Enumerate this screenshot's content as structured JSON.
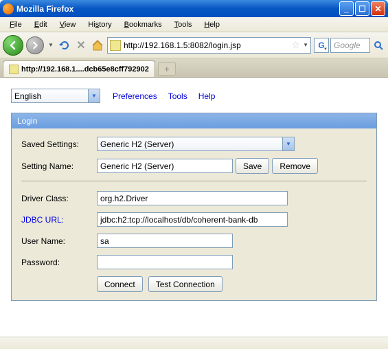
{
  "window": {
    "title": "Mozilla Firefox"
  },
  "menu": {
    "file": "File",
    "edit": "Edit",
    "view": "View",
    "history": "History",
    "bookmarks": "Bookmarks",
    "tools": "Tools",
    "help": "Help"
  },
  "nav": {
    "url": "http://192.168.1.5:8082/login.jsp",
    "search_placeholder": "Google"
  },
  "tab": {
    "title": "http://192.168.1....dcb65e8cff792902"
  },
  "toprow": {
    "language": "English",
    "preferences": "Preferences",
    "tools": "Tools",
    "help": "Help"
  },
  "panel": {
    "title": "Login",
    "labels": {
      "saved_settings": "Saved Settings:",
      "setting_name": "Setting Name:",
      "driver_class": "Driver Class:",
      "jdbc_url": "JDBC URL:",
      "user_name": "User Name:",
      "password": "Password:"
    },
    "values": {
      "saved_settings": "Generic H2 (Server)",
      "setting_name": "Generic H2 (Server)",
      "driver_class": "org.h2.Driver",
      "jdbc_url": "jdbc:h2:tcp://localhost/db/coherent-bank-db",
      "user_name": "sa",
      "password": ""
    },
    "buttons": {
      "save": "Save",
      "remove": "Remove",
      "connect": "Connect",
      "test": "Test Connection"
    }
  }
}
